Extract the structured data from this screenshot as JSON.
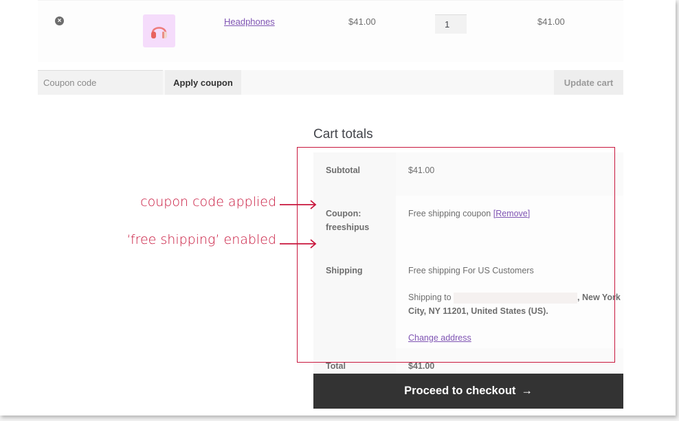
{
  "cart": {
    "items": [
      {
        "remove_icon": "×",
        "thumbnail": "headphones-image",
        "name": "Headphones",
        "price": "$41.00",
        "quantity": "1",
        "subtotal": "$41.00"
      }
    ]
  },
  "actions": {
    "coupon_placeholder": "Coupon code",
    "apply_coupon_label": "Apply coupon",
    "update_cart_label": "Update cart"
  },
  "totals": {
    "title": "Cart totals",
    "subtotal_label": "Subtotal",
    "subtotal_value": "$41.00",
    "coupon_label_line1": "Coupon:",
    "coupon_label_line2": "freeshipus",
    "coupon_value": "Free shipping coupon",
    "coupon_remove_open": "[",
    "coupon_remove_label": "Remove",
    "coupon_remove_close": "]",
    "shipping_label": "Shipping",
    "shipping_method": "Free shipping For US Customers",
    "shipping_to_prefix": "Shipping to ",
    "shipping_to_city": ", New York City, NY 11201, United States (US).",
    "change_address_label": "Change address",
    "total_label": "Total",
    "total_value": "$41.00"
  },
  "annotations": {
    "coupon_note": "coupon code applied",
    "shipping_note": "‘free shipping’ enabled",
    "accent_color": "#c8163c"
  },
  "checkout": {
    "label": "Proceed to checkout",
    "arrow_icon": "→"
  }
}
